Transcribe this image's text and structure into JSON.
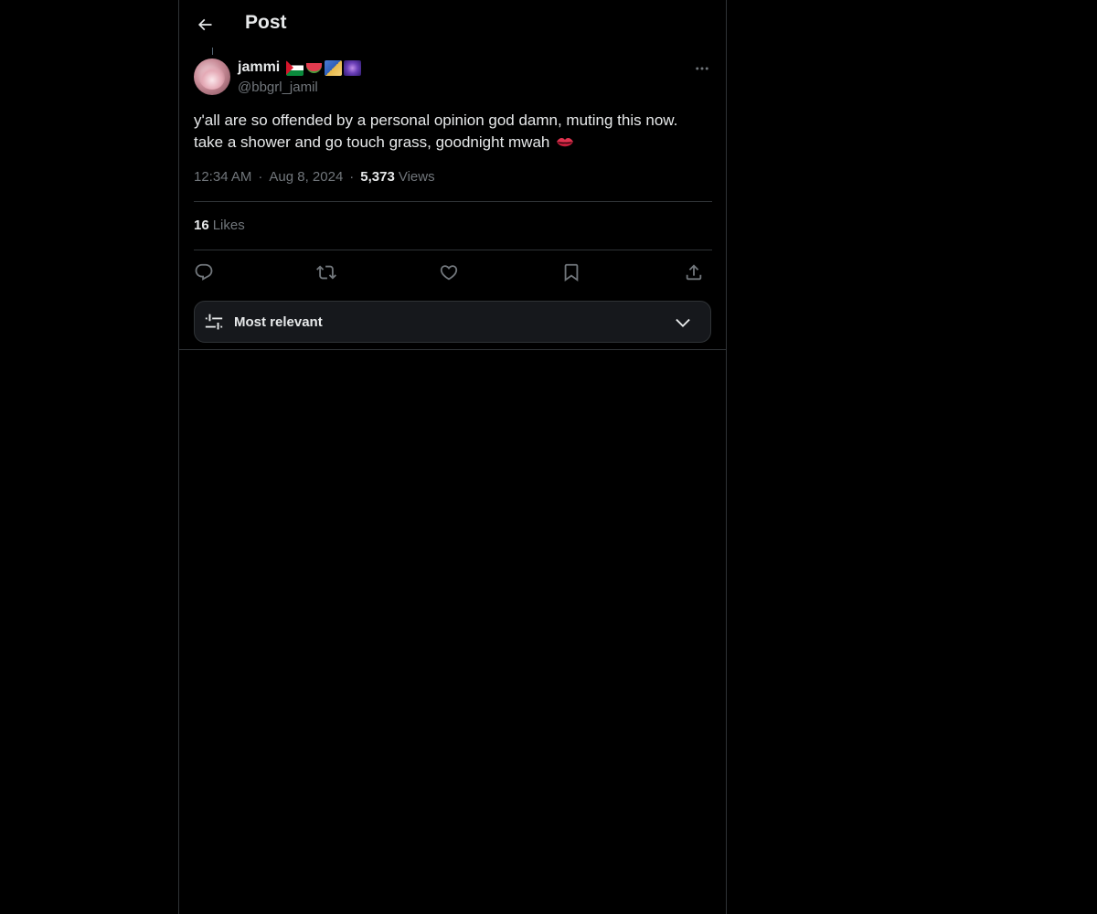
{
  "header": {
    "title": "Post",
    "back_icon": "arrow-left-icon"
  },
  "post": {
    "author": {
      "display_name": "jammi",
      "handle": "@bbgrl_jamil",
      "name_emojis": [
        "palestine-flag-emoji",
        "watermelon-emoji",
        "shooting-star-emoji",
        "milky-way-emoji"
      ]
    },
    "text_lines": [
      "y'all are so offended by a personal opinion god damn, muting this now.",
      "take a shower and go touch grass, goodnight mwah"
    ],
    "text_emoji": "kiss-mark-emoji",
    "time": "12:34 AM",
    "date": "Aug 8, 2024",
    "separator": "·",
    "views_count": "5,373",
    "views_label": "Views",
    "likes_count": "16",
    "likes_label": "Likes"
  },
  "actions": [
    {
      "name": "reply",
      "icon": "reply-icon"
    },
    {
      "name": "repost",
      "icon": "repost-icon"
    },
    {
      "name": "like",
      "icon": "heart-icon"
    },
    {
      "name": "bookmark",
      "icon": "bookmark-icon"
    },
    {
      "name": "share",
      "icon": "share-icon"
    }
  ],
  "sort": {
    "label": "Most relevant",
    "icon": "sliders-icon",
    "chevron": "chevron-down-icon"
  },
  "colors": {
    "background": "#000000",
    "text_primary": "#e7e9ea",
    "text_secondary": "#71767b",
    "border": "#2f3336",
    "sort_bg": "#16181c"
  }
}
